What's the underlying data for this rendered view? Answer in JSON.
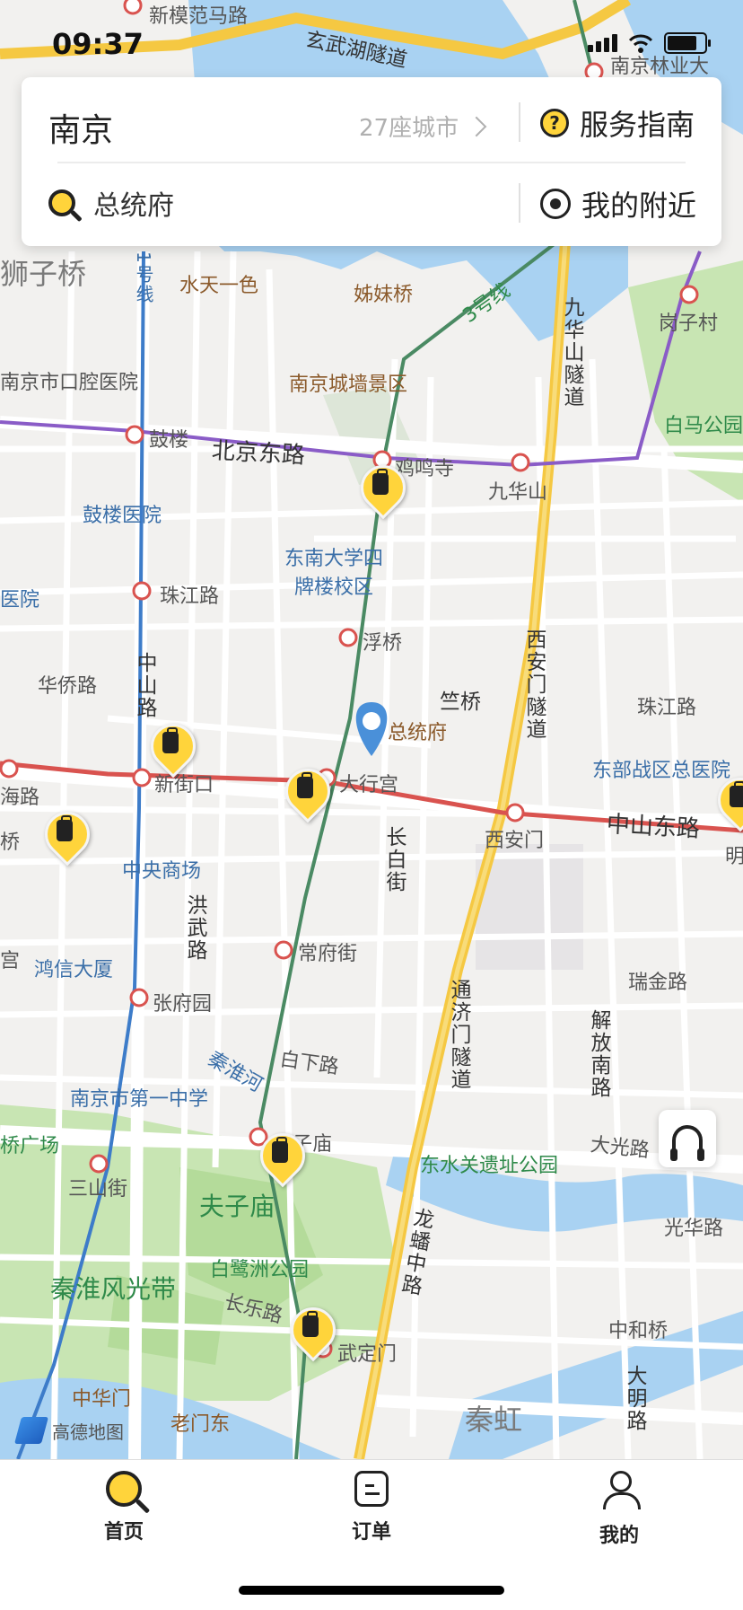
{
  "status_bar": {
    "time": "09:37"
  },
  "search_card": {
    "city": "南京",
    "city_count": "27座城市",
    "guide_label": "服务指南",
    "search_text": "总统府",
    "nearby_label": "我的附近"
  },
  "map": {
    "labels": {
      "xuanwu_tunnel": "玄武湖隧道",
      "xinmofan": "新模范马路",
      "forestry": "南京林业大",
      "shizi_bridge": "狮子桥",
      "shuitian": "水天一色",
      "jiemei_bridge": "姊妹桥",
      "line3": "3号线",
      "line1": "1号线",
      "gangzi": "岗子村",
      "jiuhua_tunnel": "九华山隧道",
      "baima": "白马公园",
      "kouqiang": "南京市口腔医院",
      "city_wall": "南京城墙景区",
      "gulou": "鼓楼",
      "beijing_e_rd": "北京东路",
      "jiming": "鸡鸣寺",
      "jiuhuashan": "九华山",
      "gulou_hospital": "鼓楼医院",
      "seu": "东南大学四牌楼校区",
      "hospital_left": "医院",
      "zhujiang_rd": "珠江路",
      "fuqiao": "浮桥",
      "zhongshan_rd": "中山路",
      "huaqiao_rd": "华侨路",
      "zhuqiao": "竺桥",
      "presidential": "总统府",
      "zhujiang_rd_e": "珠江路",
      "xian_tunnel": "西安门隧道",
      "eastern_hospital": "东部战区总医院",
      "xinjiekou": "新街口",
      "daxinggong": "大行宫",
      "hailu": "海路",
      "zhongshan_e_rd": "中山东路",
      "xianmen": "西安门",
      "changbai": "长白街",
      "qiao": "桥",
      "ming": "明",
      "central_mall": "中央商场",
      "hongwu_rd": "洪武路",
      "gong": "宫",
      "changfu": "常府街",
      "ruijin_rd": "瑞金路",
      "hongxin": "鸿信大厦",
      "zhangfu": "张府园",
      "tongji_tunnel": "通济门隧道",
      "jiefang_rd": "解放南路",
      "qinhuai_river": "秦淮河",
      "baixia_rd": "白下路",
      "nj_no1_school": "南京市第一中学",
      "dong_square": "桥广场",
      "fuzimiao_st": "夫子庙",
      "dongshuiguan": "东水关遗址公园",
      "daguang_rd": "大光路",
      "sanshan": "三山街",
      "fuzimiao": "夫子庙",
      "guanghua_rd": "光华路",
      "longpan_rd": "龙蟠中路",
      "bailuzhou": "白鹭洲公园",
      "qinhuai_scenic": "秦淮风光带",
      "changle_rd": "长乐路",
      "wuding": "武定门",
      "zhonghe_bridge": "中和桥",
      "daming_rd": "大明路",
      "zhonghua_gate": "中华门",
      "laomen_east": "老门东",
      "qinhong": "秦虹",
      "amap": "高德地图"
    }
  },
  "tabbar": {
    "home": "首页",
    "orders": "订单",
    "me": "我的"
  },
  "colors": {
    "accent_yellow": "#ffd43b",
    "metro_red": "#d9534f",
    "metro_blue": "#3d7cc9",
    "metro_green": "#4a8a63",
    "metro_purple": "#8a5cc7",
    "water": "#a9d2f2",
    "park": "#c8e5b3"
  }
}
